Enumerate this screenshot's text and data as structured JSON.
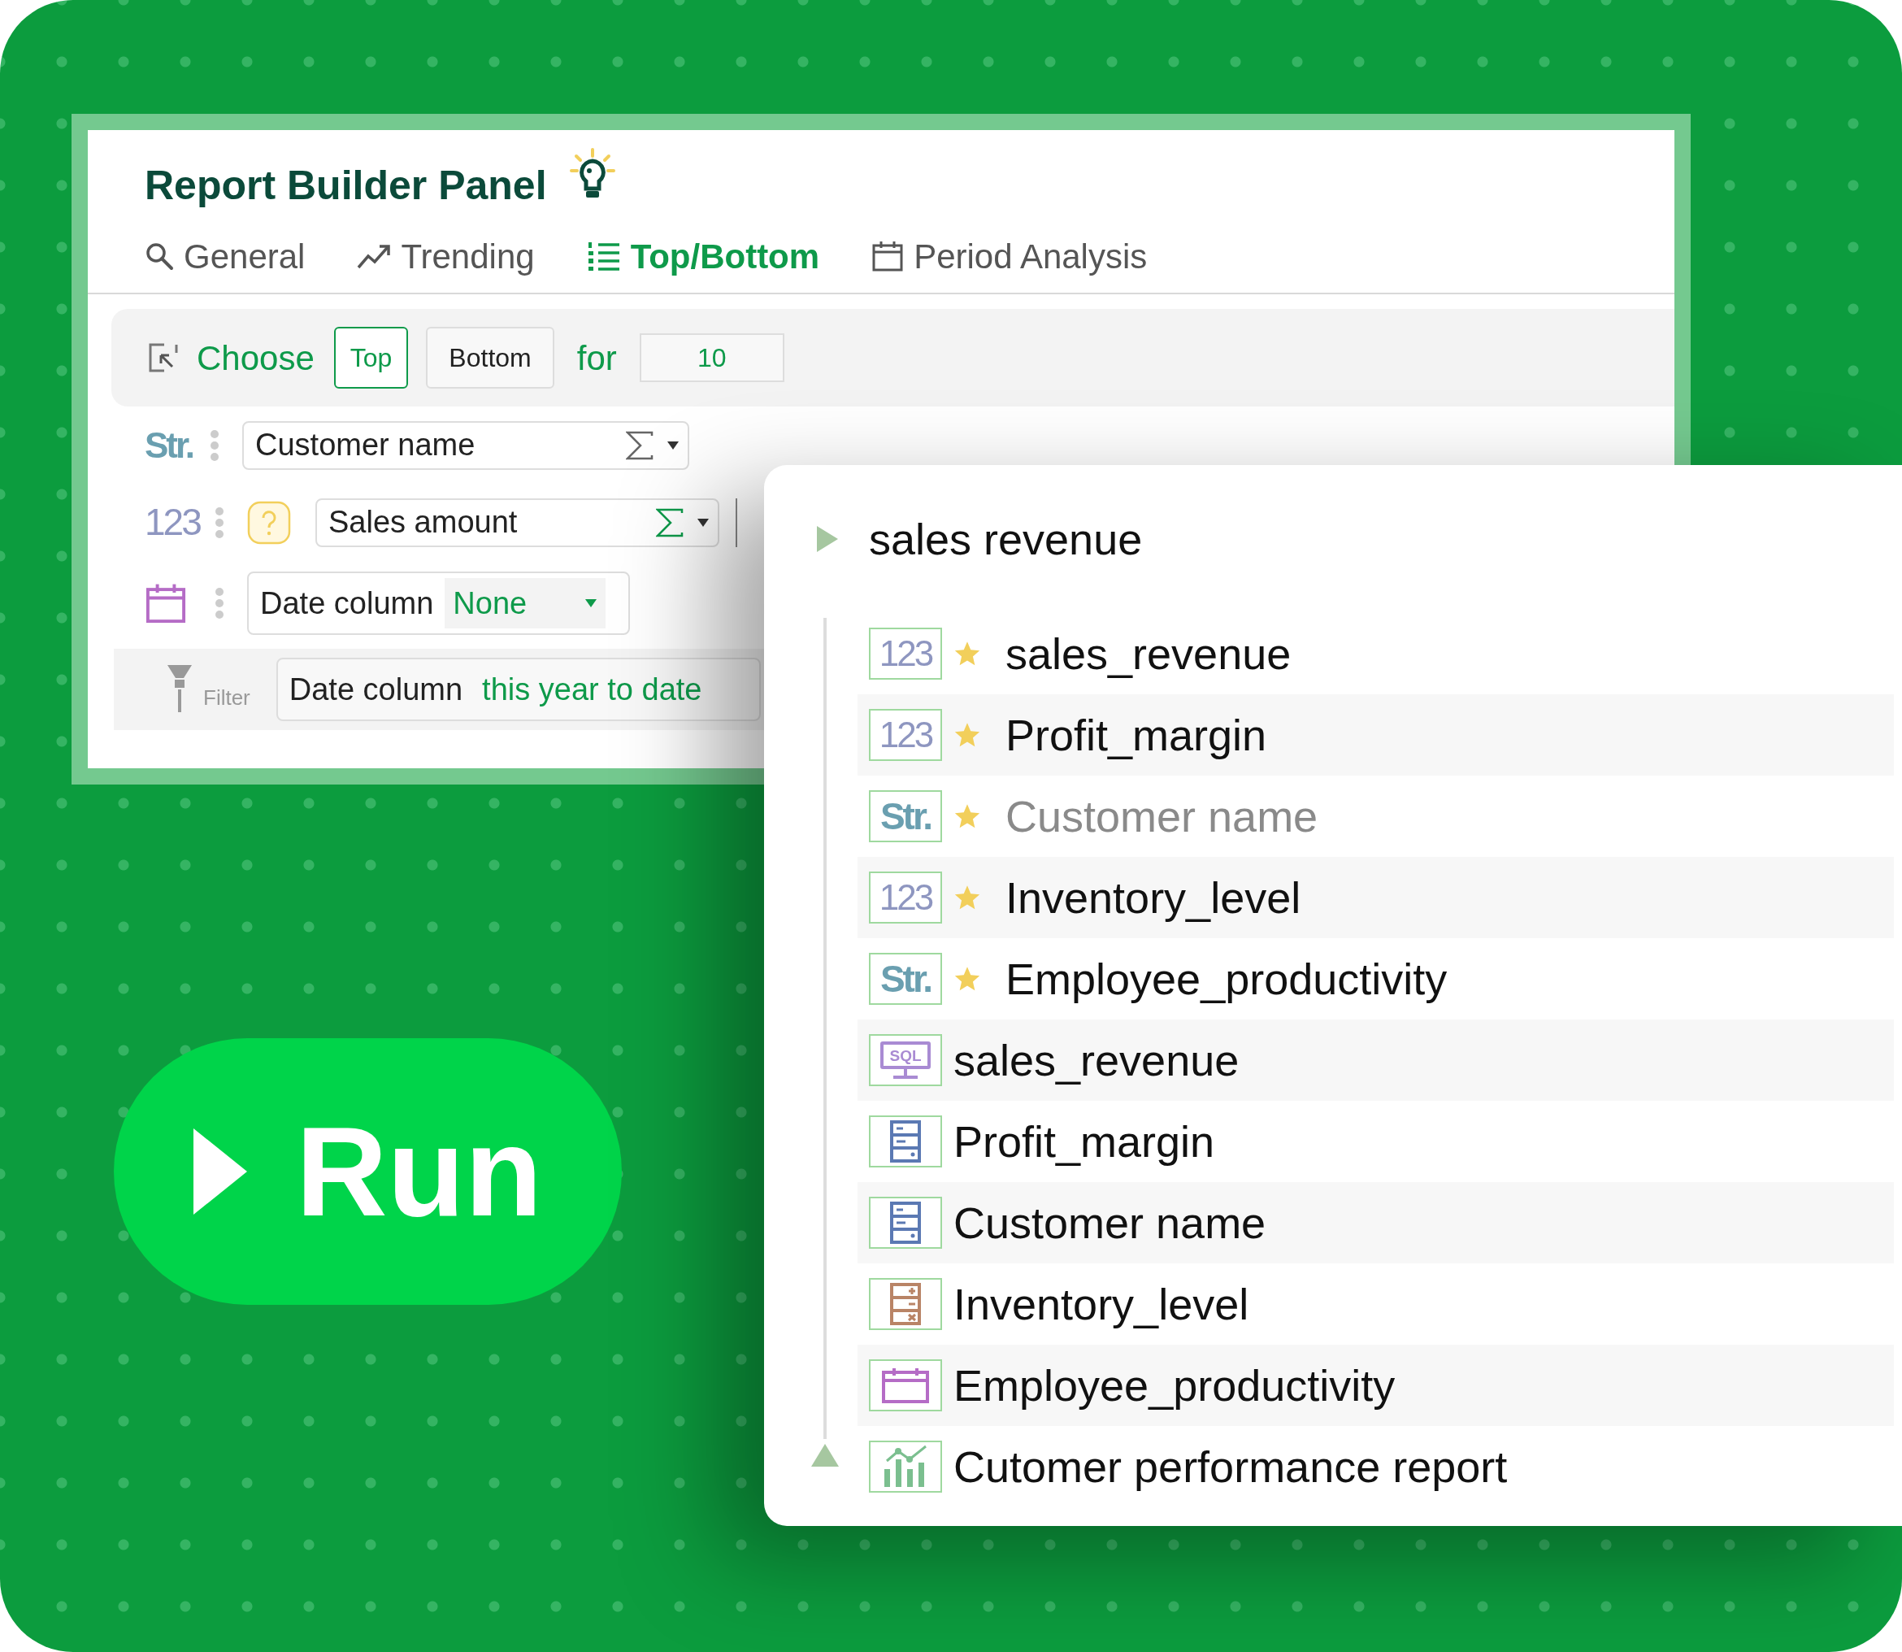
{
  "panel": {
    "title": "Report Builder Panel",
    "tabs": [
      {
        "label": "General",
        "selected": false
      },
      {
        "label": "Trending",
        "selected": false
      },
      {
        "label": "Top/Bottom",
        "selected": true
      },
      {
        "label": "Period Analysis",
        "selected": false
      }
    ],
    "choose_bar": {
      "label": "Choose",
      "options": [
        {
          "label": "Top",
          "selected": true
        },
        {
          "label": "Bottom",
          "selected": false
        }
      ],
      "for_label": "for",
      "count": "10"
    },
    "fields": [
      {
        "kind": "string",
        "type_label": "Str.",
        "value": "Customer name",
        "aggregate": false
      },
      {
        "kind": "number",
        "type_label": "123",
        "value": "Sales amount",
        "aggregate": true
      },
      {
        "kind": "date",
        "value": "Date column",
        "option": "None"
      }
    ],
    "filter": {
      "label": "Filter",
      "field": "Date column",
      "value": "this year to date"
    }
  },
  "run_button": {
    "label": "Run"
  },
  "field_list": {
    "title": "sales revenue",
    "items": [
      {
        "kind": "number",
        "type_label": "123",
        "starred": true,
        "disabled": false,
        "label": "sales_revenue"
      },
      {
        "kind": "number",
        "type_label": "123",
        "starred": true,
        "disabled": false,
        "label": "Profit_margin"
      },
      {
        "kind": "string",
        "type_label": "Str.",
        "starred": true,
        "disabled": true,
        "label": "Customer name"
      },
      {
        "kind": "number",
        "type_label": "123",
        "starred": true,
        "disabled": false,
        "label": "Inventory_level"
      },
      {
        "kind": "string",
        "type_label": "Str.",
        "starred": true,
        "disabled": false,
        "label": "Employee_productivity"
      },
      {
        "kind": "sql",
        "type_label": "SQL",
        "starred": false,
        "disabled": false,
        "label": "sales_revenue"
      },
      {
        "kind": "table",
        "starred": false,
        "disabled": false,
        "label": "Profit_margin"
      },
      {
        "kind": "table",
        "starred": false,
        "disabled": false,
        "label": "Customer name"
      },
      {
        "kind": "calc",
        "starred": false,
        "disabled": false,
        "label": "Inventory_level"
      },
      {
        "kind": "date",
        "starred": false,
        "disabled": false,
        "label": "Employee_productivity"
      },
      {
        "kind": "chart",
        "starred": false,
        "disabled": false,
        "label": "Cutomer performance report"
      }
    ]
  }
}
